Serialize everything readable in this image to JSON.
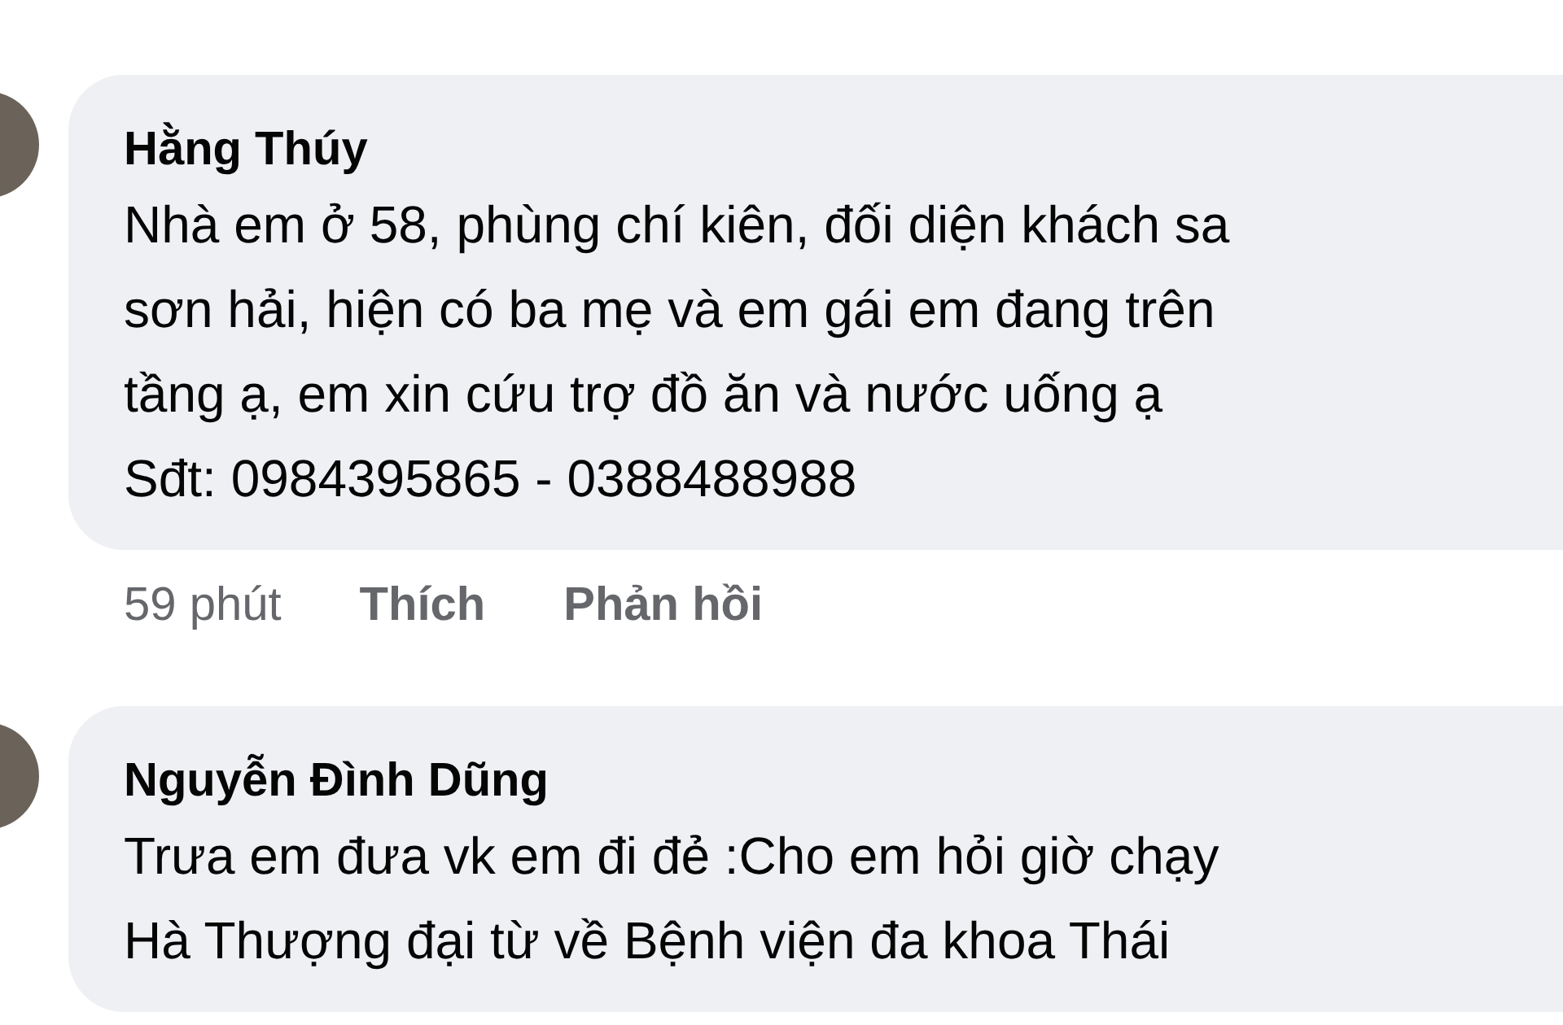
{
  "comments": [
    {
      "author": "Hằng Thúy",
      "lines": [
        "Nhà em ở 58, phùng chí kiên, đối diện khách sa",
        "sơn hải, hiện có ba mẹ và em gái em đang trên",
        "tầng ạ, em xin cứu trợ đồ ăn và nước uống ạ",
        "Sđt: 0984395865 - 0388488988"
      ],
      "time": "59 phút",
      "actions": [
        "Thích",
        "Phản hồi"
      ]
    },
    {
      "author": "Nguyễn Đình Dũng",
      "lines": [
        "Trưa em đưa vk em đi đẻ :Cho em  hỏi giờ chạy",
        "Hà Thượng đại từ về Bệnh viện đa khoa Thái"
      ]
    }
  ]
}
